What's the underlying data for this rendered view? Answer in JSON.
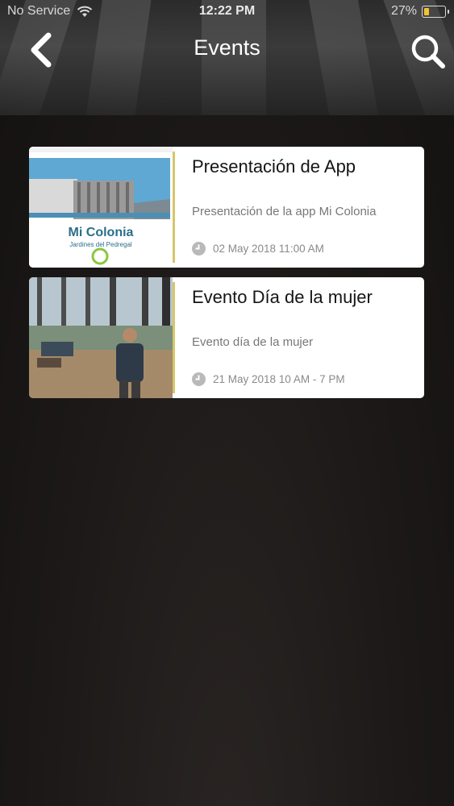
{
  "status_bar": {
    "carrier": "No Service",
    "time": "12:22 PM",
    "battery_percent": "27%",
    "battery_level": 0.27,
    "battery_color": "#f4c430"
  },
  "header": {
    "title": "Events",
    "back_icon": "chevron-left-icon",
    "search_icon": "search-icon"
  },
  "events": [
    {
      "title": "Presentación de App",
      "description": "Presentación de la app Mi Colonia",
      "date": "02 May 2018 11:00 AM",
      "thumbnail_text": "Mi Colonia",
      "thumbnail_subtext": "Jardines del Pedregal"
    },
    {
      "title": "Evento Día de la mujer",
      "description": "Evento día de la mujer",
      "date": "21 May 2018 10 AM - 7 PM"
    }
  ],
  "colors": {
    "accent_bar": "#d7c66a",
    "card_background": "#ffffff",
    "thumbnail_text": "#2a6f8a"
  }
}
